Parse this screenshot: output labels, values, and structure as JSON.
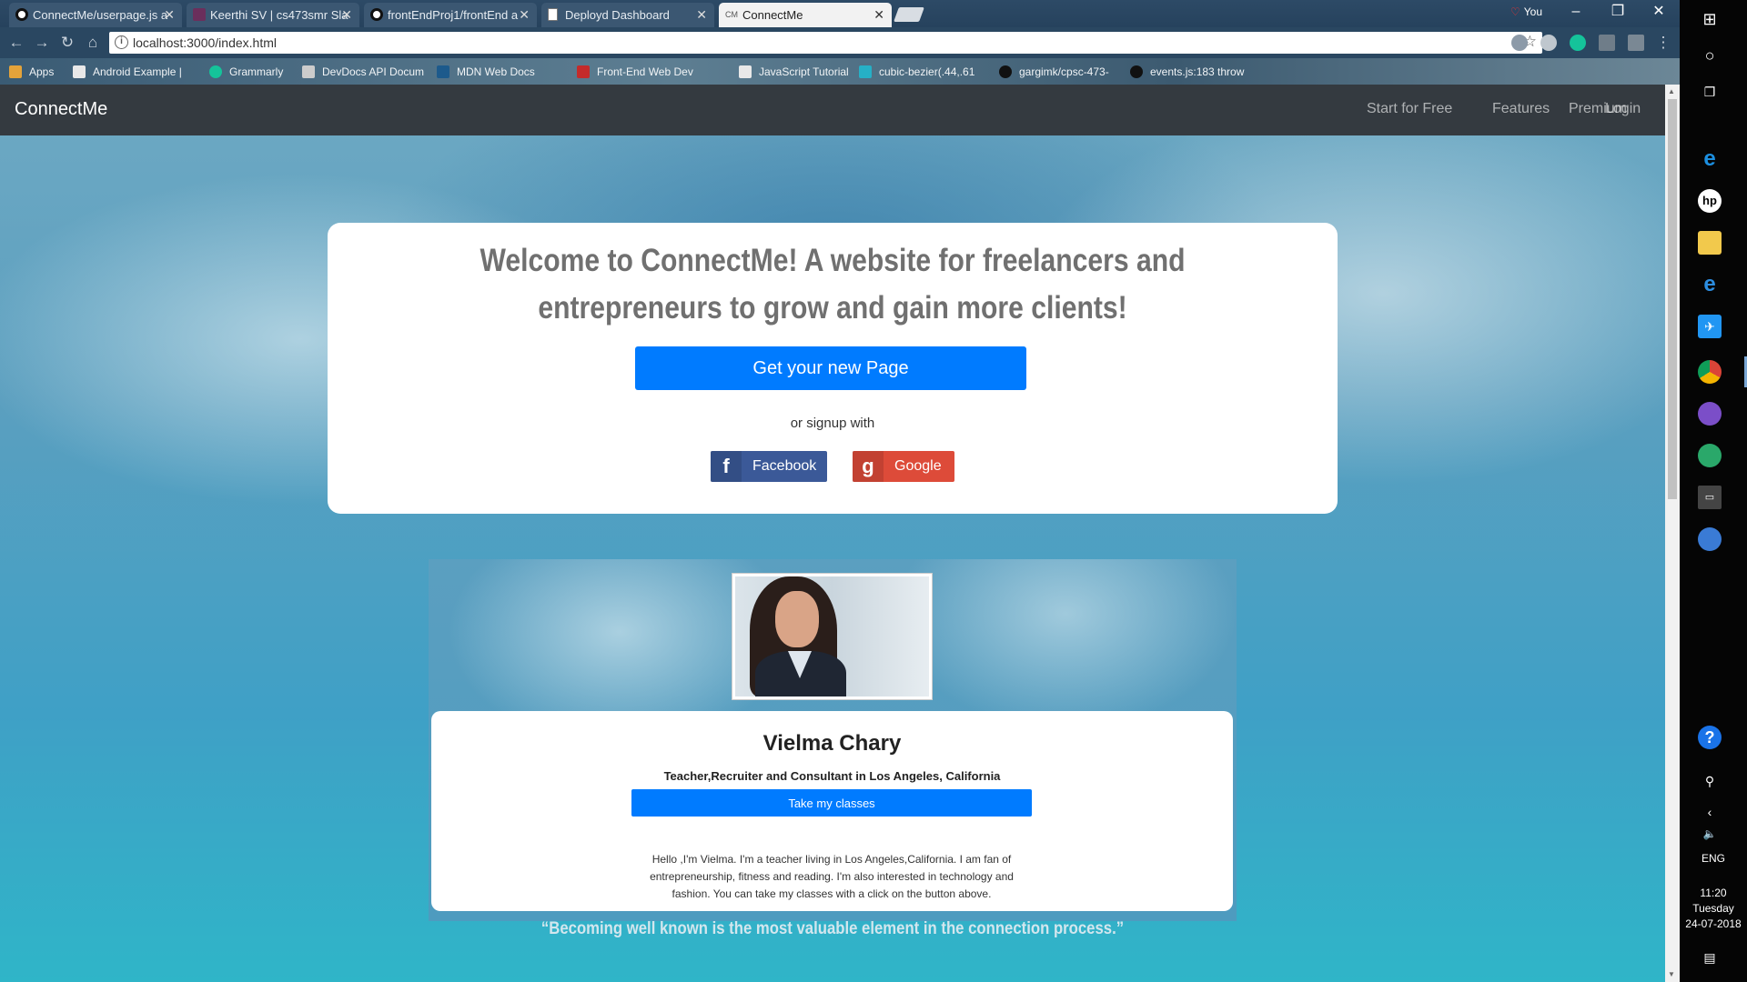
{
  "browser": {
    "tabs": [
      {
        "title": "ConnectMe/userpage.js a",
        "icon": "github-icon",
        "active": false
      },
      {
        "title": "Keerthi SV | cs473smr Sla",
        "icon": "slack-icon",
        "active": false
      },
      {
        "title": "frontEndProj1/frontEnd a",
        "icon": "github-icon",
        "active": false
      },
      {
        "title": "Deployd Dashboard",
        "icon": "document-icon",
        "active": false
      },
      {
        "title": "ConnectMe",
        "icon": "cm-icon",
        "active": true
      }
    ],
    "profile_label": "You",
    "url": "localhost:3000/index.html",
    "bookmarks": [
      "Apps",
      "Android Example |",
      "Grammarly",
      "DevDocs API Docum",
      "MDN Web Docs",
      "Front-End Web Dev",
      "JavaScript Tutorial",
      "cubic-bezier(.44,.61",
      "gargimk/cpsc-473-",
      "events.js:183 throw"
    ]
  },
  "navbar": {
    "brand": "ConnectMe",
    "links": [
      "Start for Free",
      "Features",
      "Premium",
      "Login"
    ]
  },
  "welcome": {
    "heading": "Welcome to ConnectMe! A website for freelancers and entrepreneurs to grow and gain more clients!",
    "cta_label": "Get your new Page",
    "signup_text": "or signup with",
    "facebook_label": "Facebook",
    "google_label": "Google"
  },
  "profile": {
    "name": "Vielma Chary",
    "title": "Teacher,Recruiter and Consultant in Los Angeles, California",
    "button_label": "Take my classes",
    "bio": "Hello ,I'm Vielma. I'm a teacher living in Los Angeles,California. I am fan of entrepreneurship, fitness and reading. I'm also interested in technology and fashion. You can take my classes with a click on the button above."
  },
  "quote": "“Becoming well known is the most valuable element in the connection process.”",
  "system_tray": {
    "language": "ENG",
    "time": "11:20",
    "day": "Tuesday",
    "date": "24-07-2018"
  },
  "colors": {
    "primary_button": "#007bff",
    "navbar": "#343a40",
    "facebook": "#3b5998",
    "google": "#dd4b39"
  }
}
